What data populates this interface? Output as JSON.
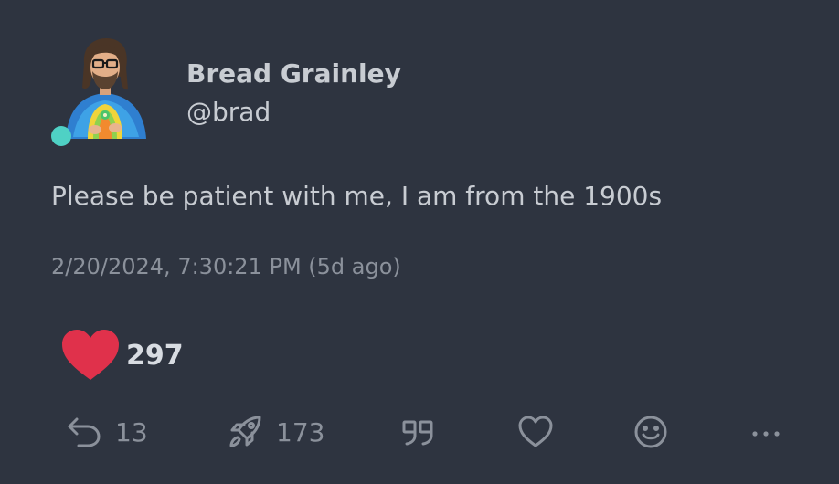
{
  "author": {
    "display_name": "Bread Grainley",
    "handle": "@brad",
    "avatar_icon": "avatar-illustration",
    "online_status_color": "#4fd1c5"
  },
  "post": {
    "text": "Please be patient with me, I am from the 1900s",
    "timestamp": "2/20/2024, 7:30:21 PM (5d ago)"
  },
  "reaction": {
    "icon": "heart-icon",
    "color": "#e0314b",
    "count": "297"
  },
  "actions": {
    "reply": {
      "icon": "reply-icon",
      "count": "13"
    },
    "boost": {
      "icon": "rocket-icon",
      "count": "173"
    },
    "quote": {
      "icon": "quote-icon"
    },
    "favorite": {
      "icon": "heart-outline-icon"
    },
    "react": {
      "icon": "smiley-icon"
    },
    "more": {
      "icon": "more-icon"
    }
  },
  "colors": {
    "background": "#2e3440",
    "text": "#c8ccd2",
    "muted": "#8b919b"
  }
}
